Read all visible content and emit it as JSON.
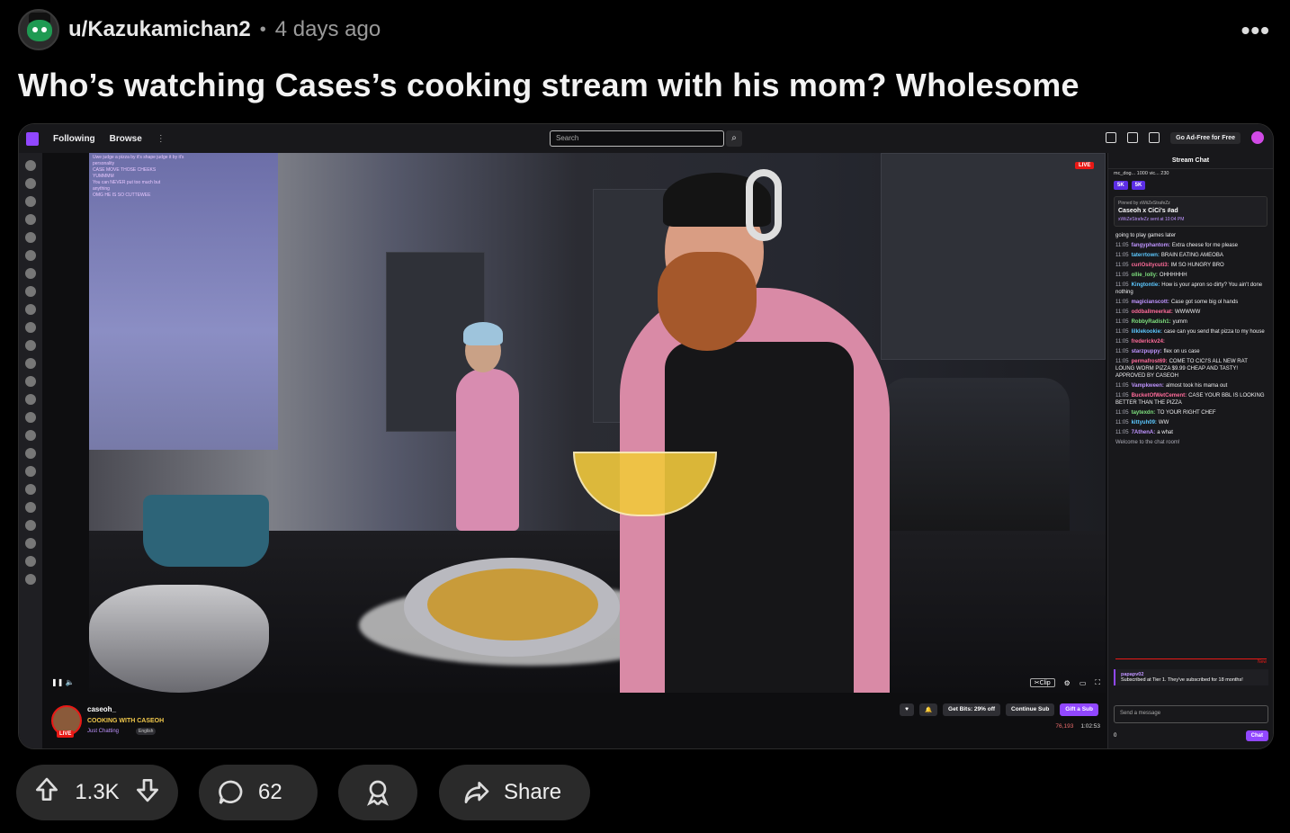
{
  "post": {
    "username": "u/Kazukamichan2",
    "separator": "•",
    "time": "4 days ago",
    "more": "•••",
    "title": "Who’s watching Cases’s cooking stream with his mom? Wholesome"
  },
  "twitch": {
    "nav": {
      "following": "Following",
      "browse": "Browse",
      "kebab": "⋮",
      "search_placeholder": "Search",
      "ad_free": "Go Ad-Free for Free"
    },
    "video": {
      "live": "LIVE",
      "overlay_lines": [
        "Uwe judge a pizza by it's shape judge it by it's",
        "personality",
        "CASE MOVE THOSE CHEEKS",
        "YUMMMM",
        "You can NEVER put too much but",
        "anything",
        "OMG HE IS SO CUTTEWEE"
      ],
      "clip": "Clip"
    },
    "stream": {
      "name": "caseoh_",
      "title": "COOKING WITH CASEOH",
      "category": "Just Chatting",
      "tag": "English",
      "live": "LIVE",
      "get_bits": "Get Bits: 29% off",
      "continue_sub": "Continue Sub",
      "gift_sub": "Gift a Sub",
      "viewers": "76,193",
      "uptime": "1:02:53"
    },
    "chat": {
      "header": "Stream Chat",
      "top_line": "mc_dog... 1000   vic... 230",
      "hype": [
        "5K",
        "5K"
      ],
      "pinned_by": "Pinned by xWiiZeStrafeZz",
      "pinned_msg": "Caseoh x CiCi's #ad",
      "pinned_sent": "xWiiZeStrafeZz sent at 10:04 PM",
      "messages": [
        {
          "time": "",
          "user": "",
          "text": "going to play games later",
          "color": "#efeff1"
        },
        {
          "time": "11:05",
          "user": "fangyphantom:",
          "text": "Extra cheese for me please",
          "color": "#bf94ff"
        },
        {
          "time": "11:05",
          "user": "taterrtown:",
          "text": "BRAIN EATING AMEOBA",
          "color": "#5cc8ff"
        },
        {
          "time": "11:05",
          "user": "curlOsitycuti3:",
          "text": "IM SO HUNGRY BRO",
          "color": "#ff6b9a"
        },
        {
          "time": "11:05",
          "user": "ollie_lolly:",
          "text": "OHHHHHH",
          "color": "#7ee07e"
        },
        {
          "time": "11:05",
          "user": "Kingtontie:",
          "text": "How is your apron so dirty? You ain't done nothing",
          "color": "#5cc8ff"
        },
        {
          "time": "11:05",
          "user": "magicianscott:",
          "text": "Case got some big ol hands",
          "color": "#bf94ff"
        },
        {
          "time": "11:05",
          "user": "oddballmeerkat:",
          "text": "WWWWW",
          "color": "#ff6b9a"
        },
        {
          "time": "11:05",
          "user": "RobbyRadish1:",
          "text": "yumm",
          "color": "#7ee07e"
        },
        {
          "time": "11:05",
          "user": "lilklekookie:",
          "text": "case can you send that pizza to my house",
          "color": "#5cc8ff"
        },
        {
          "time": "11:05",
          "user": "frederickv24:",
          "text": "",
          "color": "#ff6b9a"
        },
        {
          "time": "11:05",
          "user": "starzpuppy:",
          "text": "flex on us case",
          "color": "#bf94ff"
        },
        {
          "time": "11:05",
          "user": "permafrost69:",
          "text": "COME TO CICI'S ALL NEW RAT LOUNG WORM PIZZA $9.99 CHEAP AND TASTY! APPROVED BY CASEOH",
          "color": "#ff6b9a"
        },
        {
          "time": "11:05",
          "user": "Vampkween:",
          "text": "almost took his mama out",
          "color": "#bf94ff"
        },
        {
          "time": "11:05",
          "user": "BucketOfWetCement:",
          "text": "CASE YOUR BBL IS LOOKING BETTER THAN THE PIZZA",
          "color": "#ff6b9a"
        },
        {
          "time": "11:05",
          "user": "taytexdn:",
          "text": "TO YOUR RIGHT CHEF",
          "color": "#7ee07e"
        },
        {
          "time": "11:05",
          "user": "kittyuh09:",
          "text": "WW",
          "color": "#5cc8ff"
        },
        {
          "time": "11:05",
          "user": "7AthenA:",
          "text": "a what",
          "color": "#bf94ff"
        },
        {
          "time": "",
          "user": "",
          "text": "Welcome to the chat room!",
          "color": "#adadb8"
        }
      ],
      "new_label": "New",
      "sub_user": "papapv02",
      "sub_text": "Subscribed at Tier 1. They've subscribed for 18 months!",
      "input_placeholder": "Send a message",
      "points": "0",
      "chat_button": "Chat"
    }
  },
  "actions": {
    "votes": "1.3K",
    "comments": "62",
    "share": "Share"
  }
}
